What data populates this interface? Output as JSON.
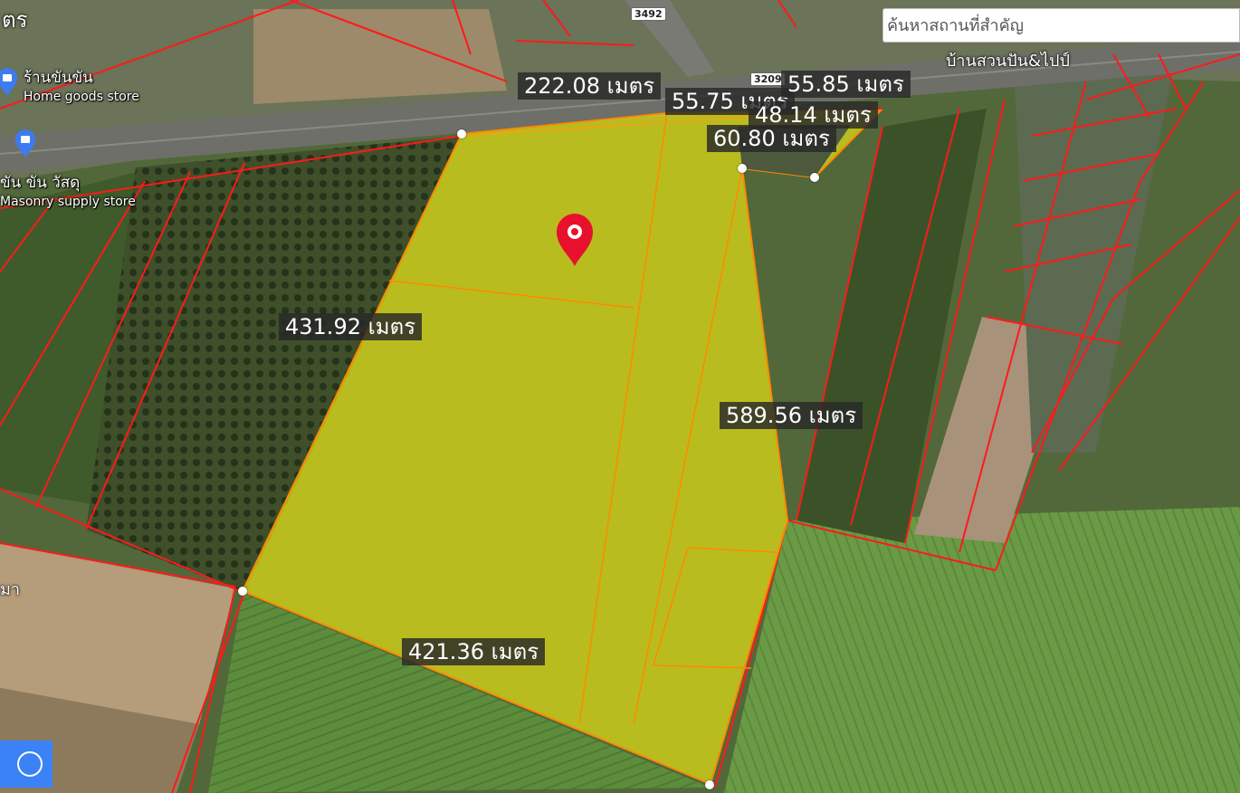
{
  "search": {
    "placeholder": "ค้นหาสถานที่สำคัญ"
  },
  "area_label": "บ้านสวนปัน&ไปป์",
  "corner_top_left": "ตร",
  "corner_left_mid": "มา",
  "route_shields": [
    "3492",
    "3209"
  ],
  "pois": [
    {
      "name": "ร้านขันขัน",
      "category": "Home goods store"
    },
    {
      "name": "ขัน ขัน วัสดุ",
      "category": "Masonry supply store"
    }
  ],
  "measurements": [
    "222.08 เมตร",
    "55.75 เมตร",
    "55.85 เมตร",
    "48.14 เมตร",
    "60.80 เมตร",
    "431.92 เมตร",
    "589.56 เมตร",
    "421.36 เมตร"
  ],
  "colors": {
    "parcel_fill": "#e0dc14",
    "parcel_line": "#ff1a1a",
    "marker": "#e8112d",
    "button": "#3b82f6"
  },
  "icons": {
    "marker": "location-pin-icon",
    "poi": "shopping-bag-pin-icon",
    "tool": "circle-draw-icon"
  }
}
